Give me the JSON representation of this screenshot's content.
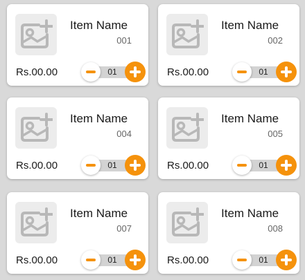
{
  "colors": {
    "accent": "#f5920c",
    "card": "#ffffff",
    "background": "#d9d9d9"
  },
  "icons": {
    "placeholder": "image-add-icon",
    "decrement": "minus-icon",
    "increment": "plus-icon"
  },
  "items": [
    {
      "name": "Item Name",
      "code": "001",
      "price": "Rs.00.00",
      "qty": "01"
    },
    {
      "name": "Item Name",
      "code": "002",
      "price": "Rs.00.00",
      "qty": "01"
    },
    {
      "name": "Item Name",
      "code": "004",
      "price": "Rs.00.00",
      "qty": "01"
    },
    {
      "name": "Item Name",
      "code": "005",
      "price": "Rs.00.00",
      "qty": "01"
    },
    {
      "name": "Item Name",
      "code": "007",
      "price": "Rs.00.00",
      "qty": "01"
    },
    {
      "name": "Item Name",
      "code": "008",
      "price": "Rs.00.00",
      "qty": "01"
    }
  ]
}
